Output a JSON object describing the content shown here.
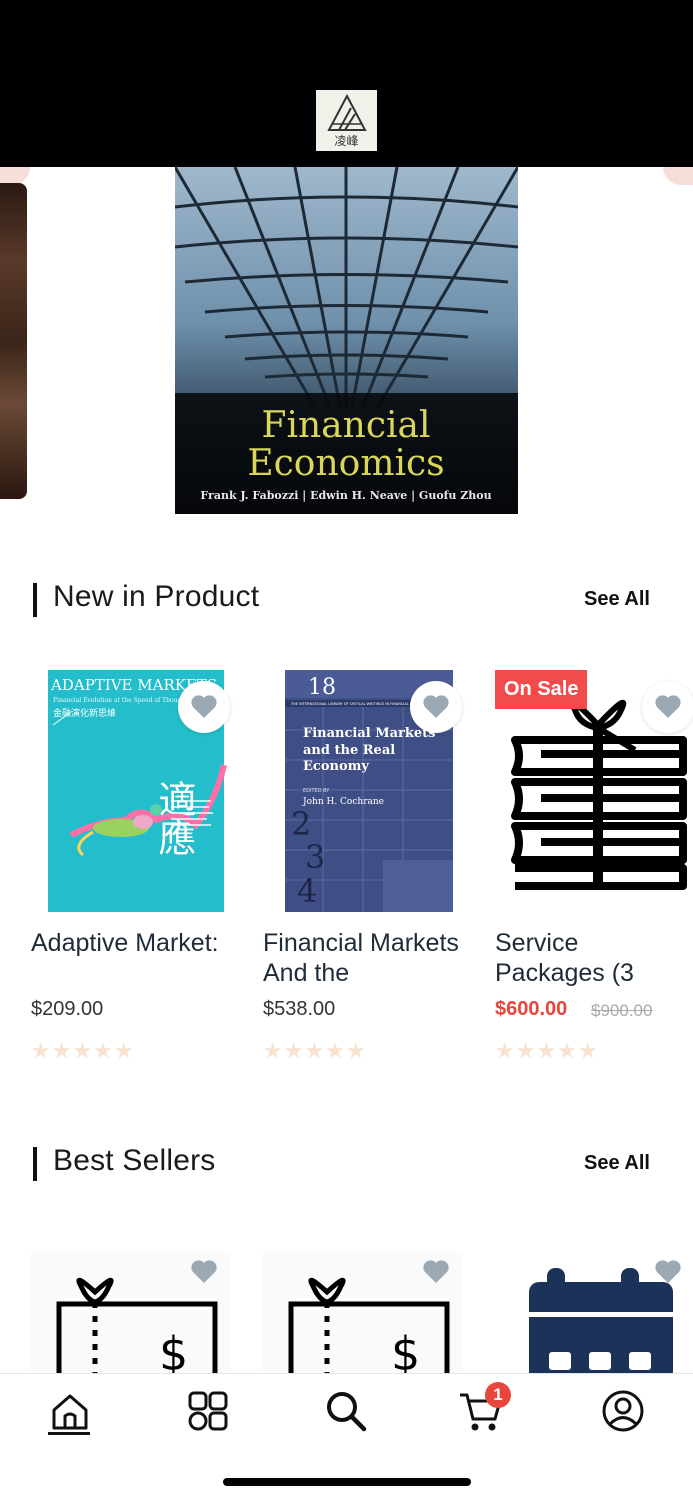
{
  "header": {
    "logo_text": "凌峰"
  },
  "banner": {
    "book_title_line1": "Financial",
    "book_title_line2": "Economics",
    "book_authors": "Frank J. Fabozzi  |  Edwin H. Neave  |  Guofu Zhou"
  },
  "new_in_product": {
    "title": "New in Product",
    "see_all": "See All",
    "items": [
      {
        "name": "Adaptive Market:",
        "price": "$209.00",
        "cover_title": "ADAPTIVE MARKETS",
        "cover_subtitle": "Financial Evolution at the Speed of Thought",
        "cover_cn": "金融演化新思維",
        "cover_big": "適應",
        "rating": "★★★★★"
      },
      {
        "name": "Financial Markets And the",
        "price": "$538.00",
        "cover_number": "18",
        "cover_series": "THE INTERNATIONAL LIBRARY OF CRITICAL WRITINGS IN FINANCIAL ECONOMICS",
        "cover_title": "Financial Markets and the Real Economy",
        "cover_editor_label": "EDITED BY",
        "cover_editor": "John H. Cochrane",
        "rating": "★★★★★"
      },
      {
        "name": "Service Packages (3",
        "price": "$600.00",
        "old_price": "$900.00",
        "badge": "On Sale",
        "rating": "★★★★★"
      }
    ]
  },
  "best_sellers": {
    "title": "Best Sellers",
    "see_all": "See All",
    "items": [
      {
        "icon": "gift-card-dollar-icon",
        "symbol": "$"
      },
      {
        "icon": "gift-card-dollar-icon",
        "symbol": "$"
      },
      {
        "icon": "calendar-icon"
      }
    ]
  },
  "bottom_nav": {
    "items": [
      "home-icon",
      "categories-icon",
      "search-icon",
      "cart-icon",
      "profile-icon"
    ],
    "cart_count": "1"
  },
  "colors": {
    "accent": "#e8453c",
    "heart": "#9aa9b4",
    "star": "#f7e3d0"
  }
}
